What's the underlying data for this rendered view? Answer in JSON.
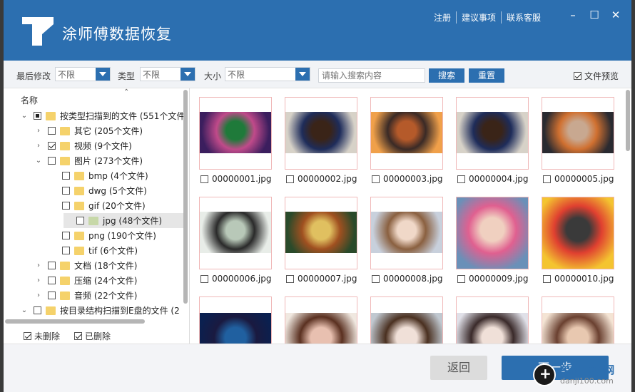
{
  "app": {
    "title": "涂师傅数据恢复",
    "links": [
      "注册",
      "建议事项",
      "联系客服"
    ]
  },
  "filters": {
    "modified_label": "最后修改",
    "modified_value": "不限",
    "type_label": "类型",
    "type_value": "不限",
    "size_label": "大小",
    "size_value": "不限",
    "search_placeholder": "请输入搜索内容",
    "search_button": "搜索",
    "reset_button": "重置",
    "preview_label": "文件预览",
    "preview_checked": true
  },
  "tree": {
    "header": "名称",
    "items": [
      {
        "label": "按类型扫描到的文件 (551个文件)",
        "level": 0,
        "expanded": true,
        "check": "partial"
      },
      {
        "label": "其它 (205个文件)",
        "level": 1,
        "expanded": false,
        "check": "none"
      },
      {
        "label": "视频 (9个文件)",
        "level": 1,
        "expanded": false,
        "check": "checked"
      },
      {
        "label": "图片 (273个文件)",
        "level": 1,
        "expanded": true,
        "check": "none"
      },
      {
        "label": "bmp (4个文件)",
        "level": 2,
        "expanded": null,
        "check": "none"
      },
      {
        "label": "dwg (5个文件)",
        "level": 2,
        "expanded": null,
        "check": "none"
      },
      {
        "label": "gif (20个文件)",
        "level": 2,
        "expanded": null,
        "check": "none"
      },
      {
        "label": "jpg (48个文件)",
        "level": 2,
        "expanded": null,
        "check": "none",
        "selected": true
      },
      {
        "label": "png (190个文件)",
        "level": 2,
        "expanded": null,
        "check": "none"
      },
      {
        "label": "tif (6个文件)",
        "level": 2,
        "expanded": null,
        "check": "none"
      },
      {
        "label": "文档 (18个文件)",
        "level": 1,
        "expanded": false,
        "check": "none"
      },
      {
        "label": "压缩 (24个文件)",
        "level": 1,
        "expanded": false,
        "check": "none"
      },
      {
        "label": "音频 (22个文件)",
        "level": 1,
        "expanded": false,
        "check": "none"
      },
      {
        "label": "按目录结构扫描到E盘的文件 (2",
        "level": 0,
        "expanded": true,
        "check": "none"
      }
    ],
    "footer": {
      "undeleted": "未删除",
      "deleted": "已删除"
    }
  },
  "files": [
    {
      "name": "00000001.jpg",
      "colors": [
        "#3b1e5e",
        "#1f7a3a",
        "#c04a8a"
      ]
    },
    {
      "name": "00000002.jpg",
      "colors": [
        "#d7d2c8",
        "#3a2418",
        "#1e2c5a"
      ]
    },
    {
      "name": "00000003.jpg",
      "colors": [
        "#f0a04a",
        "#b55a2a",
        "#3a2a26"
      ]
    },
    {
      "name": "00000004.jpg",
      "colors": [
        "#d7d2c8",
        "#3a2418",
        "#1e2c5a"
      ]
    },
    {
      "name": "00000005.jpg",
      "colors": [
        "#2a2a30",
        "#c8a890",
        "#d07030"
      ]
    },
    {
      "name": "00000006.jpg",
      "colors": [
        "#e8ede8",
        "#b8c8b8",
        "#2a2a2a"
      ]
    },
    {
      "name": "00000007.jpg",
      "colors": [
        "#2a4a2a",
        "#e0c060",
        "#a05020"
      ]
    },
    {
      "name": "00000008.jpg",
      "colors": [
        "#c8d0dc",
        "#f0d8c8",
        "#8a6040"
      ]
    },
    {
      "name": "00000009.jpg",
      "colors": [
        "#6a90b8",
        "#f0d0c0",
        "#e06090"
      ]
    },
    {
      "name": "00000010.jpg",
      "colors": [
        "#f4c430",
        "#3a3a3a",
        "#e04030"
      ]
    },
    {
      "name": "",
      "colors": [
        "#0a2050",
        "#2060a0",
        "#1a1a40"
      ]
    },
    {
      "name": "",
      "colors": [
        "#f0e8e0",
        "#e8c0b0",
        "#5a3020"
      ]
    },
    {
      "name": "",
      "colors": [
        "#c0c8d0",
        "#f0e0d8",
        "#4a3020"
      ]
    },
    {
      "name": "",
      "colors": [
        "#e0e0e8",
        "#f0e0d8",
        "#3a2a2a"
      ]
    },
    {
      "name": "",
      "colors": [
        "#f4e4d4",
        "#e8c8b0",
        "#6a4030"
      ]
    }
  ],
  "footer": {
    "back": "返回",
    "next": "下一步"
  },
  "watermark": {
    "line1": "单机100网",
    "line2": "danji100.com"
  },
  "colors": {
    "accent": "#2c6fb0"
  }
}
